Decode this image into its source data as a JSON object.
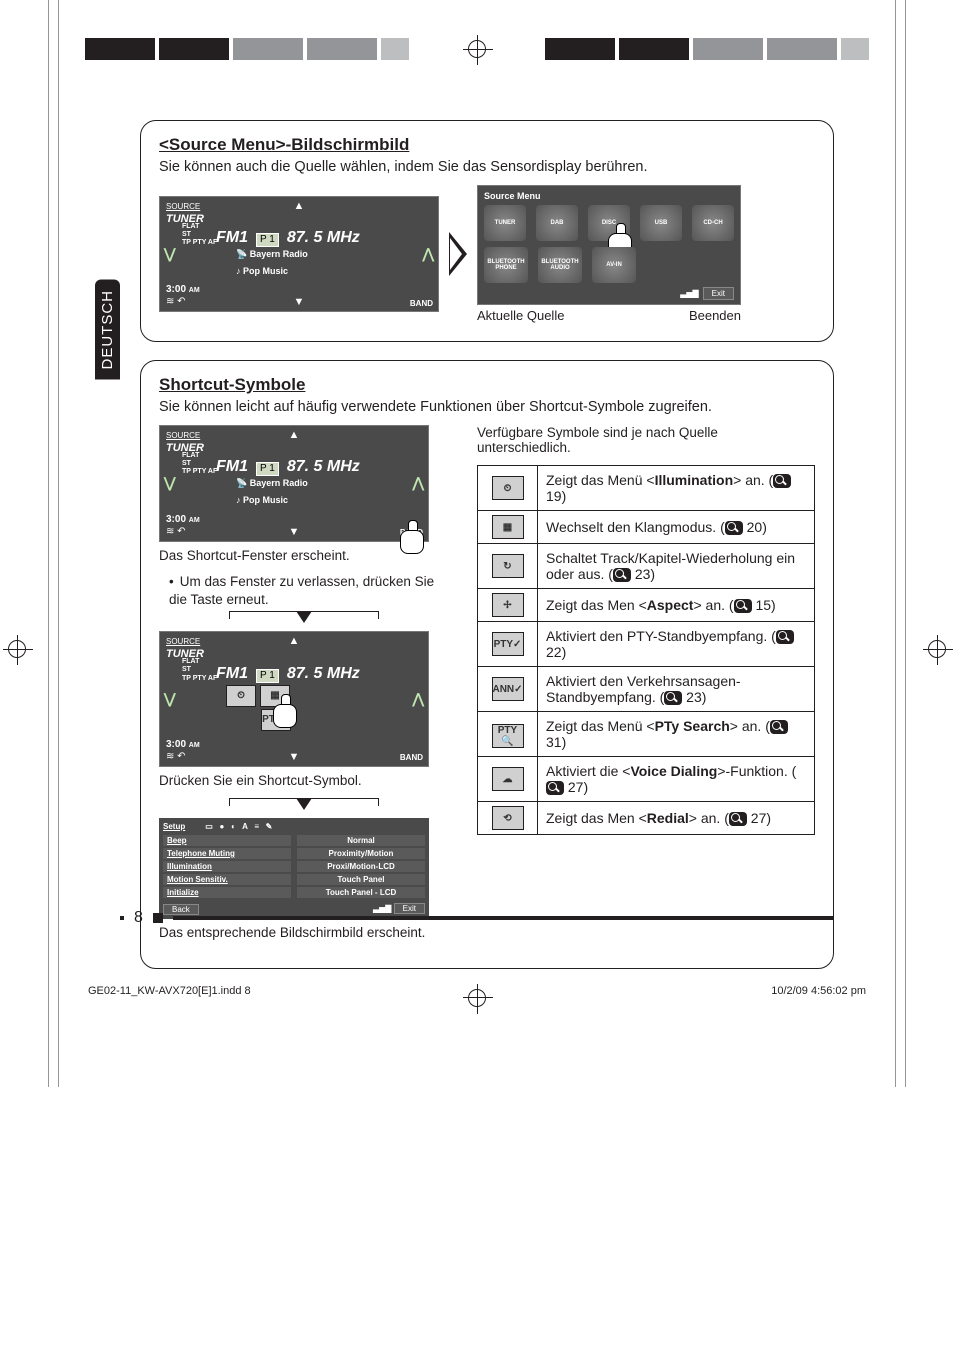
{
  "lang_tab": "DEUTSCH",
  "page_number": "8",
  "footer_left": "GE02-11_KW-AVX720[E]1.indd   8",
  "footer_right": "10/2/09   4:56:02 pm",
  "source_menu_section": {
    "heading": "<Source Menu>-Bildschirmbild",
    "intro": "Sie können auch die Quelle wählen, indem Sie das Sensordisplay berühren.",
    "tuner": {
      "source_label": "SOURCE",
      "tuner_label": "TUNER",
      "fm": "FM1",
      "preset": "P 1",
      "freq": "87. 5 MHz",
      "flat": "FLAT",
      "st": "ST",
      "tp_pty_af": "TP  PTY  AF",
      "station": "Bayern Radio",
      "music": "Pop Music",
      "clock": "3:00",
      "clock_ampm": "AM",
      "band": "BAND"
    },
    "menu": {
      "title": "Source Menu",
      "items_row1": [
        "TUNER",
        "DAB",
        "DISC",
        "USB",
        "CD-CH"
      ],
      "items_row2": [
        "BLUETOOTH PHONE",
        "BLUETOOTH AUDIO",
        "AV-IN"
      ],
      "exit": "Exit",
      "cap_left": "Aktuelle Quelle",
      "cap_right": "Beenden"
    }
  },
  "shortcut_section": {
    "heading": "Shortcut-Symbole",
    "intro": "Sie können leicht auf häufig verwendete Funktionen über Shortcut-Symbole zugreifen.",
    "cap1": "Das Shortcut-Fenster erscheint.",
    "bullet1": "Um das Fenster zu verlassen, drücken Sie die Taste erneut.",
    "cap2": "Drücken Sie ein Shortcut-Symbol.",
    "cap3": "Das entsprechende Bildschirmbild erscheint.",
    "setup": {
      "title": "Setup",
      "left_items": [
        "Beep",
        "Telephone Muting",
        "Illumination",
        "Motion Sensitiv.",
        "Initialize"
      ],
      "right_items": [
        "Normal",
        "Proximity/Motion",
        "Proxi/Motion-LCD",
        "Touch Panel",
        "Touch Panel - LCD"
      ],
      "back": "Back",
      "exit": "Exit"
    },
    "right_intro": "Verfügbare Symbole sind je nach Quelle unterschiedlich.",
    "rows": [
      {
        "icon": "illum",
        "pre": "Zeigt das Menü <",
        "bold": "Illumination",
        "post": "> an. (",
        "page": "19",
        "suffix": ")"
      },
      {
        "icon": "eq",
        "text": "Wechselt den Klangmodus. (",
        "page": "20",
        "suffix": ")"
      },
      {
        "icon": "repeat",
        "text": "Schaltet Track/Kapitel-Wiederholung ein oder aus. (",
        "page": "23",
        "suffix": ")"
      },
      {
        "icon": "aspect",
        "pre": "Zeigt das Men <",
        "bold": "Aspect",
        "post": "> an. (",
        "page": "15",
        "suffix": ")"
      },
      {
        "icon": "pty",
        "text": "Aktiviert den PTY-Standbyempfang. (",
        "page": "22",
        "suffix": ")"
      },
      {
        "icon": "ann",
        "text": "Aktiviert den Verkehrsansagen-Standbyempfang. (",
        "page": "23",
        "suffix": ")"
      },
      {
        "icon": "ptys",
        "pre": "Zeigt das Menü <",
        "bold": "PTy Search",
        "post": "> an. (",
        "page": "31",
        "suffix": ")"
      },
      {
        "icon": "voice",
        "pre": "Aktiviert die <",
        "bold": "Voice Dialing",
        "post": ">-Funktion. (",
        "page": "27",
        "suffix": ")"
      },
      {
        "icon": "redial",
        "pre": "Zeigt das Men <",
        "bold": "Redial",
        "post": "> an. (",
        "page": "27",
        "suffix": ")"
      }
    ]
  }
}
